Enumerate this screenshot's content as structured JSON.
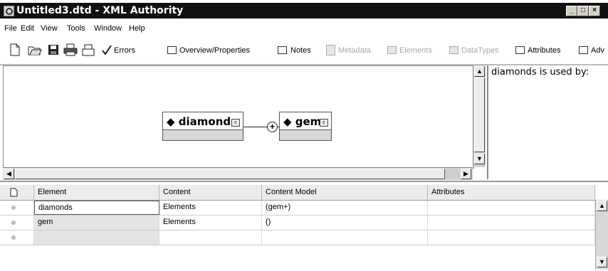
{
  "window": {
    "title": "Untitled3.dtd - XML Authority"
  },
  "menu": [
    "File",
    "Edit",
    "View",
    "Tools",
    "Window",
    "Help"
  ],
  "toolbar": {
    "errors": "Errors",
    "overview": "Overview/Properties",
    "notes": "Notes",
    "metadata": "Metadata",
    "elements": "Elements",
    "datatypes": "DataTypes",
    "attributes": "Attributes",
    "adv": "Adv"
  },
  "diagram": {
    "root": "diamonds",
    "child": "gem",
    "connector_symbol": "+"
  },
  "usedby": {
    "text": "diamonds is used by:"
  },
  "grid": {
    "headers": [
      "Element",
      "Content",
      "Content Model",
      "Attributes"
    ],
    "rows": [
      {
        "element": "diamonds",
        "content": "Elements",
        "model": "(gem+)",
        "attributes": ""
      },
      {
        "element": "gem",
        "content": "Elements",
        "model": "()",
        "attributes": ""
      },
      {
        "element": "",
        "content": "",
        "model": "",
        "attributes": ""
      }
    ]
  }
}
